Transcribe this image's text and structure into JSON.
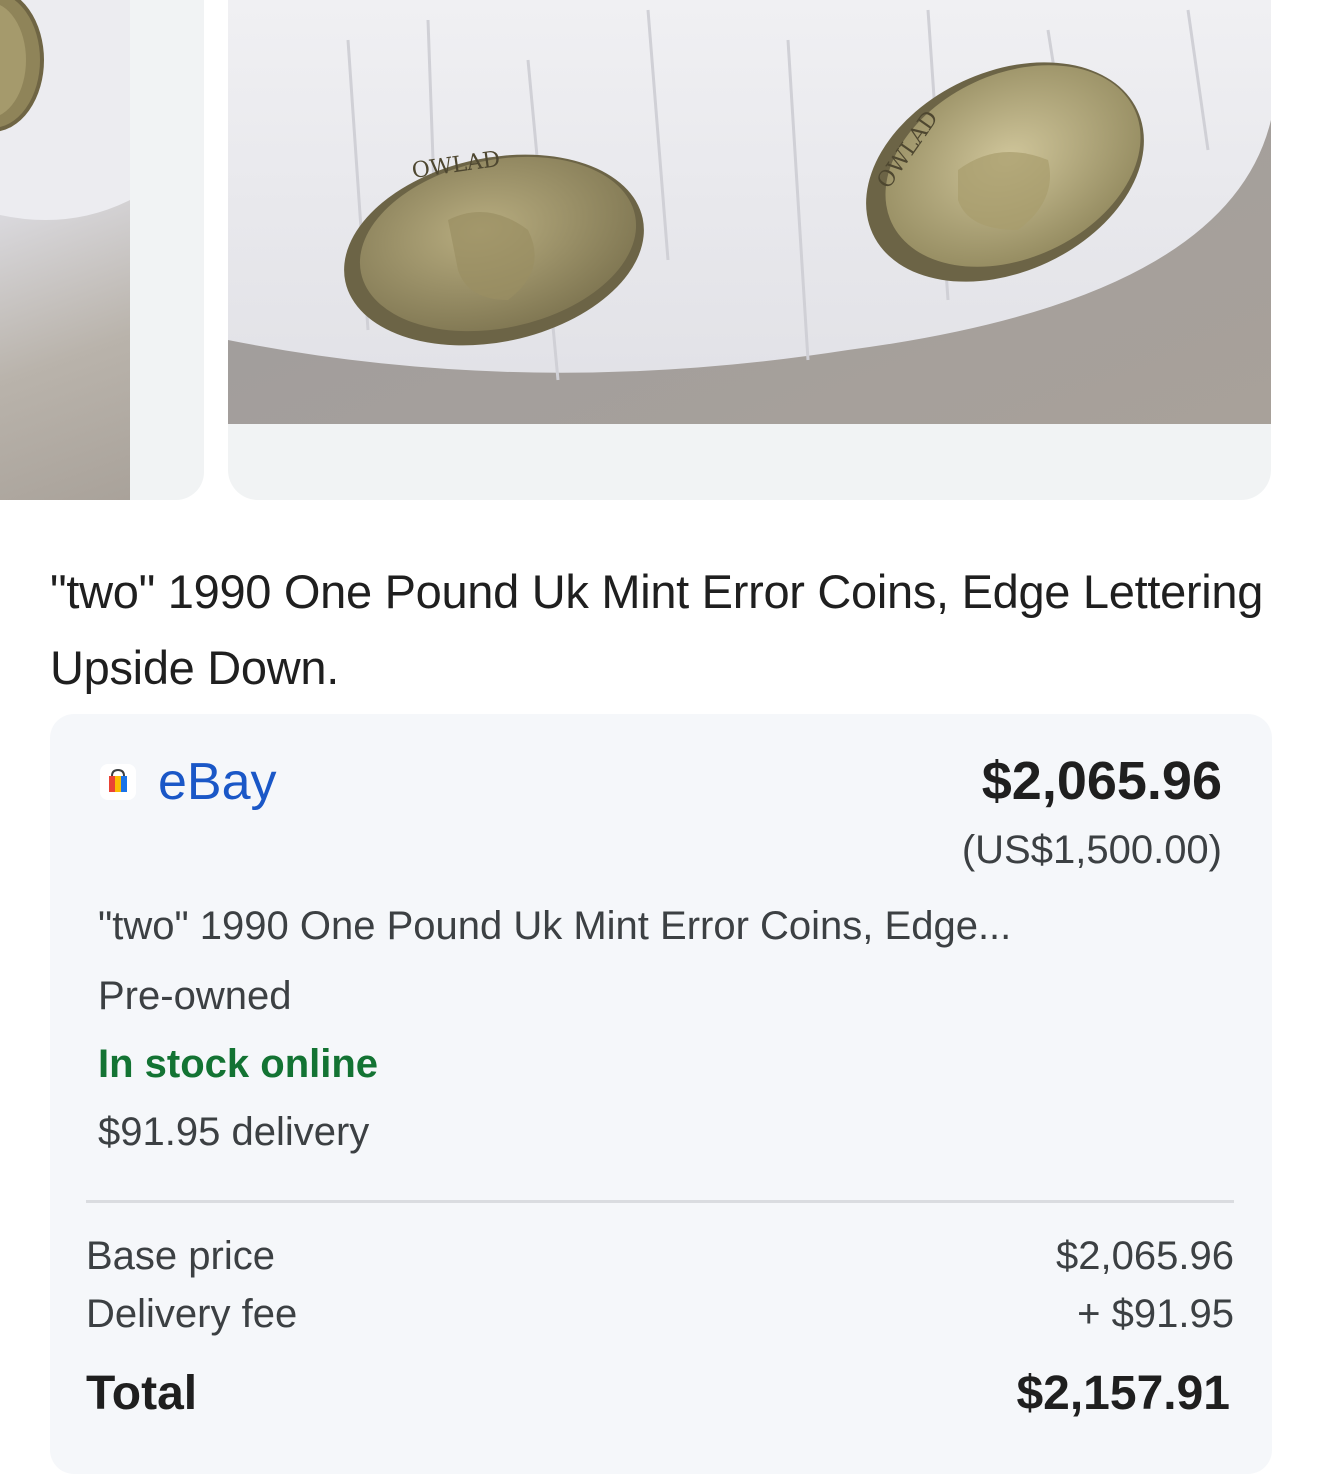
{
  "gallery": {
    "main_image_edge_text_left": "OWLAD",
    "main_image_edge_text_right": "OWLAD"
  },
  "product": {
    "title": "\"two\" 1990 One Pound Uk Mint Error Coins, Edge Lettering Upside Down."
  },
  "offer": {
    "store_name": "eBay",
    "store_logo_icon": "shopping-bag-icon",
    "price": "$2,065.96",
    "original_price": "(US$1,500.00)",
    "item_name": "\"two\" 1990 One Pound Uk Mint Error Coins, Edge...",
    "condition": "Pre-owned",
    "stock_status": "In stock online",
    "delivery": "$91.95 delivery"
  },
  "breakdown": {
    "base_label": "Base price",
    "base_value": "$2,065.96",
    "delivery_label": "Delivery fee",
    "delivery_value": "+ $91.95",
    "total_label": "Total",
    "total_value": "$2,157.91"
  },
  "colors": {
    "store_link": "#1a57c7",
    "in_stock": "#137333",
    "card_background": "#f5f7fa"
  }
}
